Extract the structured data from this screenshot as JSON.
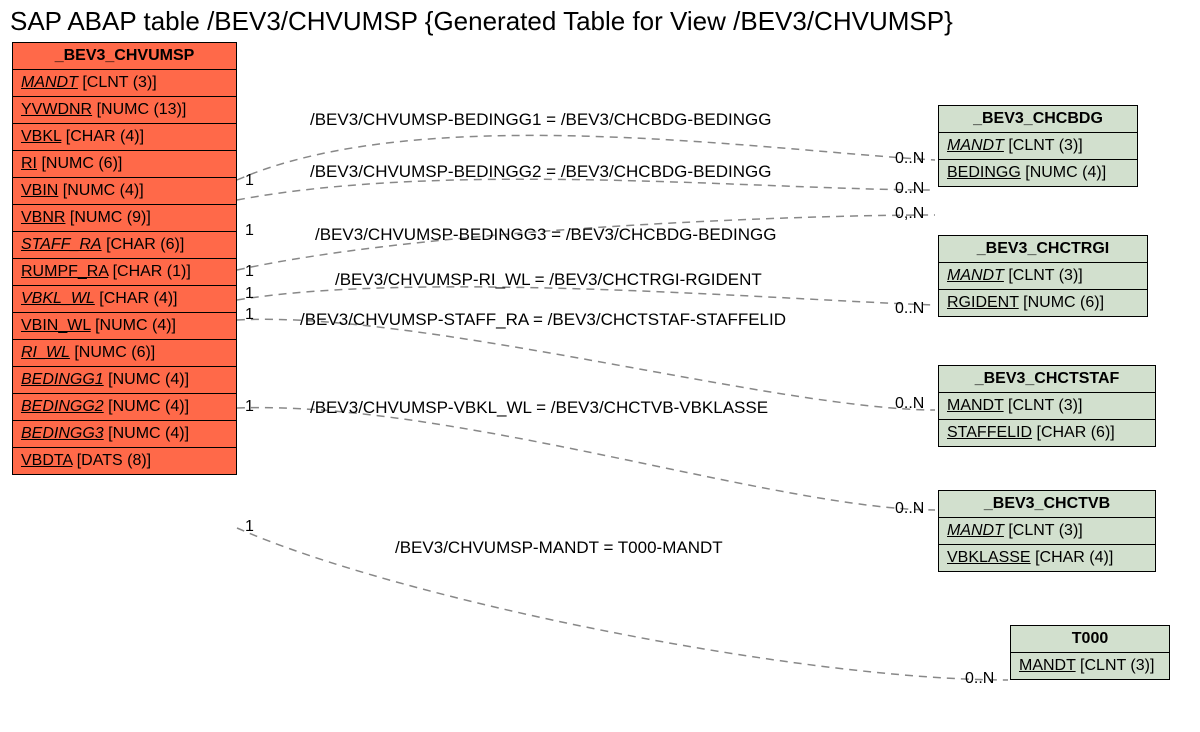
{
  "title": "SAP ABAP table /BEV3/CHVUMSP {Generated Table for View /BEV3/CHVUMSP}",
  "main": {
    "name": "_BEV3_CHVUMSP",
    "fields": [
      {
        "name": "MANDT",
        "type": "[CLNT (3)]",
        "fk": true
      },
      {
        "name": "YVWDNR",
        "type": "[NUMC (13)]",
        "fk": false
      },
      {
        "name": "VBKL",
        "type": "[CHAR (4)]",
        "fk": false
      },
      {
        "name": "RI",
        "type": "[NUMC (6)]",
        "fk": false
      },
      {
        "name": "VBIN",
        "type": "[NUMC (4)]",
        "fk": false
      },
      {
        "name": "VBNR",
        "type": "[NUMC (9)]",
        "fk": false
      },
      {
        "name": "STAFF_RA",
        "type": "[CHAR (6)]",
        "fk": true
      },
      {
        "name": "RUMPF_RA",
        "type": "[CHAR (1)]",
        "fk": false
      },
      {
        "name": "VBKL_WL",
        "type": "[CHAR (4)]",
        "fk": true
      },
      {
        "name": "VBIN_WL",
        "type": "[NUMC (4)]",
        "fk": false
      },
      {
        "name": "RI_WL",
        "type": "[NUMC (6)]",
        "fk": true
      },
      {
        "name": "BEDINGG1",
        "type": "[NUMC (4)]",
        "fk": true
      },
      {
        "name": "BEDINGG2",
        "type": "[NUMC (4)]",
        "fk": true
      },
      {
        "name": "BEDINGG3",
        "type": "[NUMC (4)]",
        "fk": true
      },
      {
        "name": "VBDTA",
        "type": "[DATS (8)]",
        "fk": false
      }
    ]
  },
  "sides": {
    "chcbdg": {
      "name": "_BEV3_CHCBDG",
      "fields": [
        {
          "name": "MANDT",
          "type": "[CLNT (3)]",
          "fk": true
        },
        {
          "name": "BEDINGG",
          "type": "[NUMC (4)]",
          "fk": false
        }
      ]
    },
    "chctrgi": {
      "name": "_BEV3_CHCTRGI",
      "fields": [
        {
          "name": "MANDT",
          "type": "[CLNT (3)]",
          "fk": true
        },
        {
          "name": "RGIDENT",
          "type": "[NUMC (6)]",
          "fk": false
        }
      ]
    },
    "chctstaf": {
      "name": "_BEV3_CHCTSTAF",
      "fields": [
        {
          "name": "MANDT",
          "type": "[CLNT (3)]",
          "fk": false
        },
        {
          "name": "STAFFELID",
          "type": "[CHAR (6)]",
          "fk": false
        }
      ]
    },
    "chctvb": {
      "name": "_BEV3_CHCTVB",
      "fields": [
        {
          "name": "MANDT",
          "type": "[CLNT (3)]",
          "fk": true
        },
        {
          "name": "VBKLASSE",
          "type": "[CHAR (4)]",
          "fk": false
        }
      ]
    },
    "t000": {
      "name": "T000",
      "fields": [
        {
          "name": "MANDT",
          "type": "[CLNT (3)]",
          "fk": false
        }
      ]
    }
  },
  "relations": {
    "r1": "/BEV3/CHVUMSP-BEDINGG1 = /BEV3/CHCBDG-BEDINGG",
    "r2": "/BEV3/CHVUMSP-BEDINGG2 = /BEV3/CHCBDG-BEDINGG",
    "r3": "/BEV3/CHVUMSP-BEDINGG3 = /BEV3/CHCBDG-BEDINGG",
    "r4": "/BEV3/CHVUMSP-RI_WL = /BEV3/CHCTRGI-RGIDENT",
    "r5": "/BEV3/CHVUMSP-STAFF_RA = /BEV3/CHCTSTAF-STAFFELID",
    "r6": "/BEV3/CHVUMSP-VBKL_WL = /BEV3/CHCTVB-VBKLASSE",
    "r7": "/BEV3/CHVUMSP-MANDT = T000-MANDT"
  },
  "cards": {
    "one": "1",
    "zn": "0..N",
    "zndot": "0,.N"
  }
}
